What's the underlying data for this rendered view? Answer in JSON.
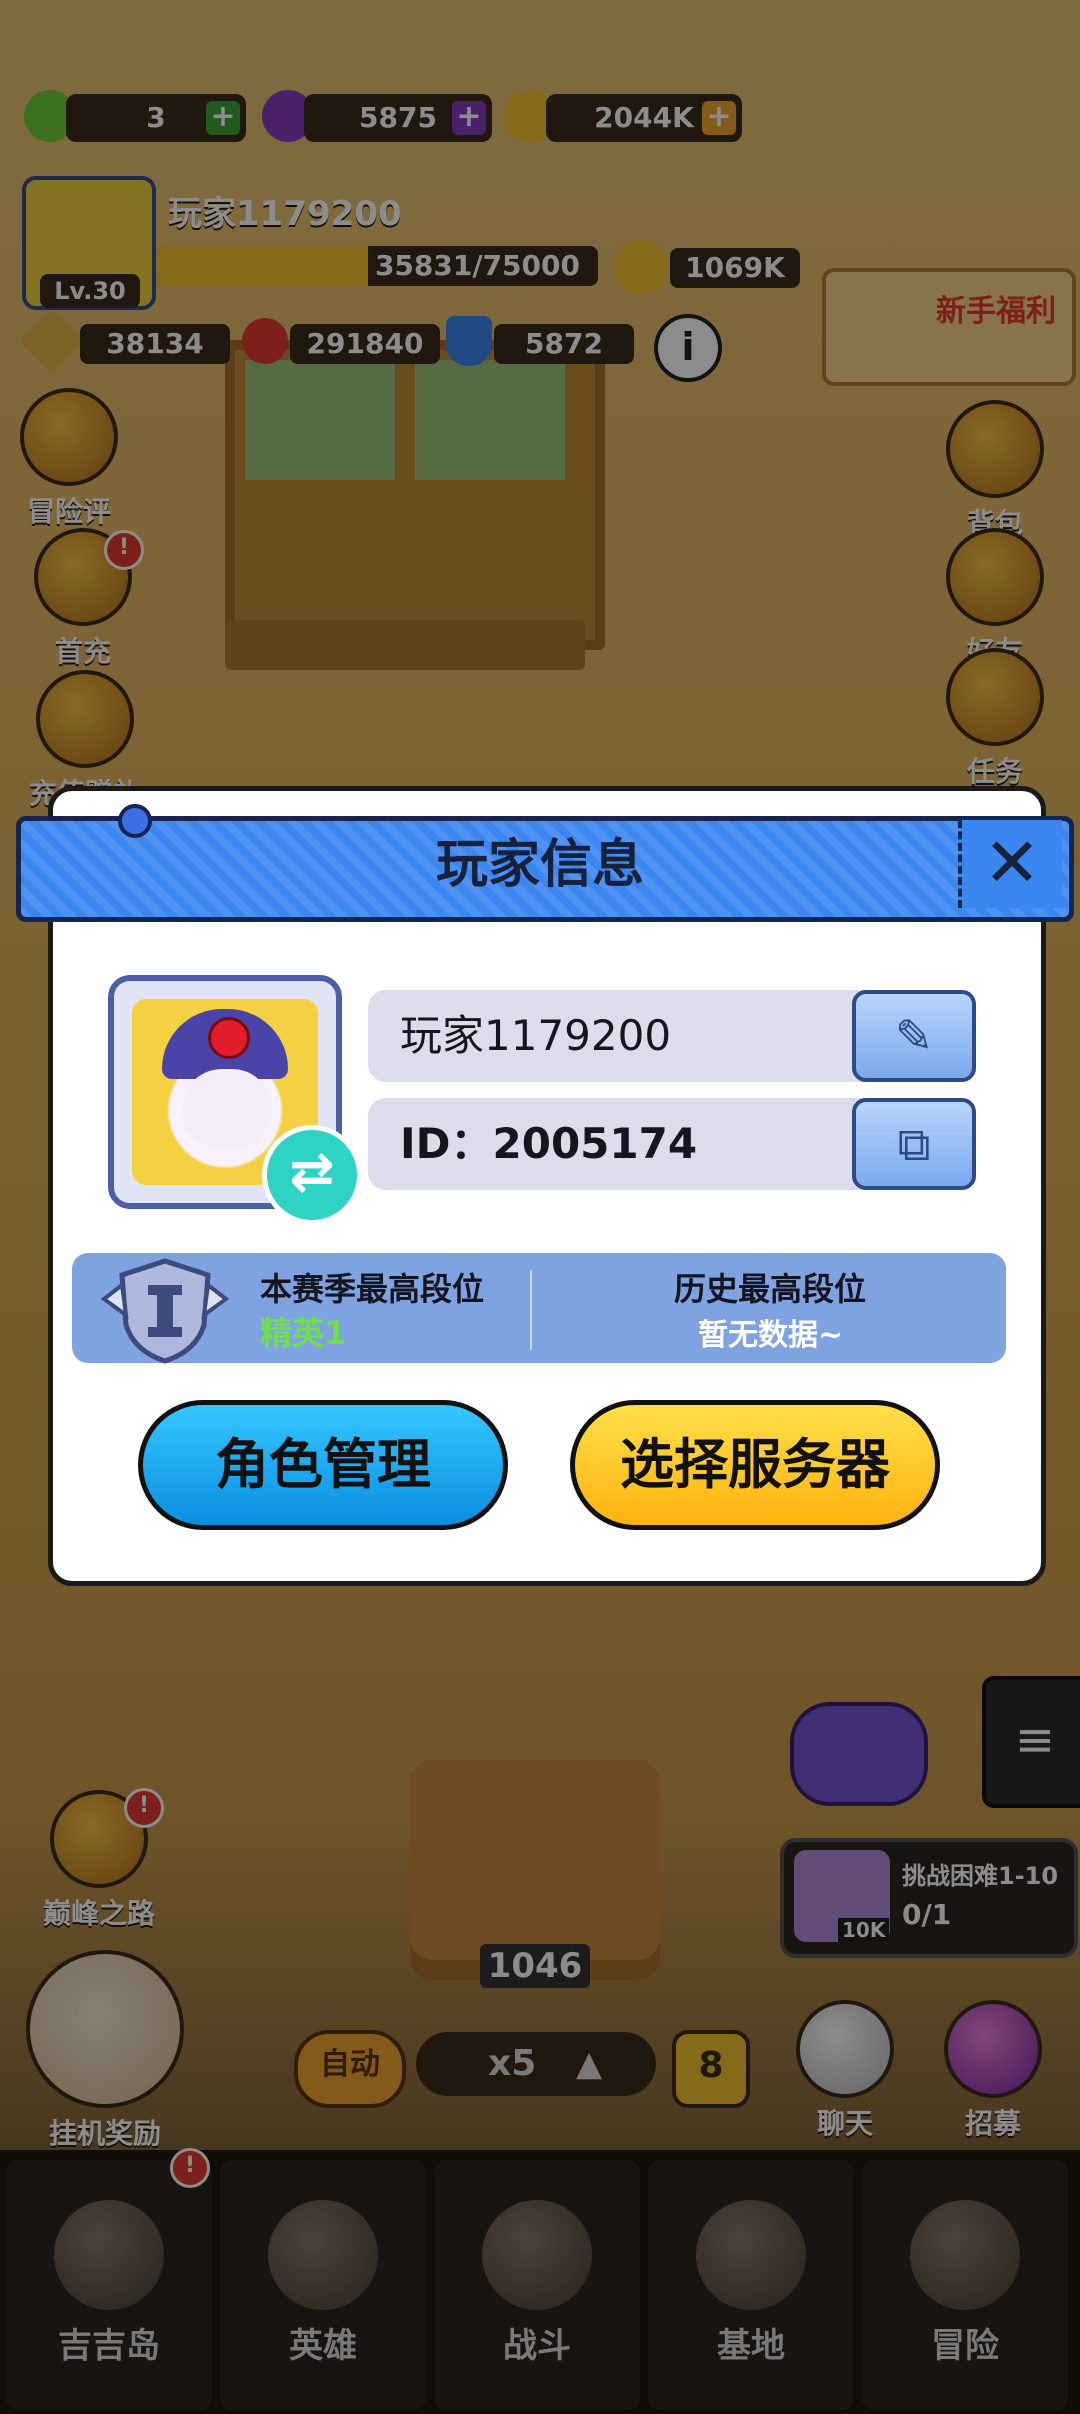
{
  "resources": {
    "energy": "3",
    "gems": "5875",
    "coins": "2044K"
  },
  "player": {
    "name": "玩家1179200",
    "level": "Lv.30",
    "exp": "35831/75000",
    "exp_fraction": 0.478,
    "power": "1069K",
    "attack": "38134",
    "hp": "291840",
    "defense": "5872"
  },
  "promo_banner": "新手福利",
  "left_menu": [
    "冒险评级",
    "首充",
    "充值赠礼"
  ],
  "right_menu": [
    "背包",
    "好友",
    "任务"
  ],
  "modal": {
    "title": "玩家信息",
    "close": "✕",
    "player_name": "玩家1179200",
    "player_id": "ID：2005174",
    "season_rank_label": "本赛季最高段位",
    "season_rank_value": "精英1",
    "history_rank_label": "历史最高段位",
    "history_rank_value": "暂无数据~",
    "role_button": "角色管理",
    "server_button": "选择服务器"
  },
  "lower": {
    "peak_road": "巅峰之路",
    "idle_reward": "挂机奖励",
    "challenge_title": "挑战困难1-10",
    "challenge_progress": "0/1",
    "challenge_reward": "10K",
    "box_count": "1046",
    "auto": "自动",
    "speed": "x5",
    "speed_badge": "8",
    "chat": "聊天",
    "recruit": "招募"
  },
  "nav": [
    "吉吉岛",
    "英雄",
    "战斗",
    "基地",
    "冒险"
  ]
}
